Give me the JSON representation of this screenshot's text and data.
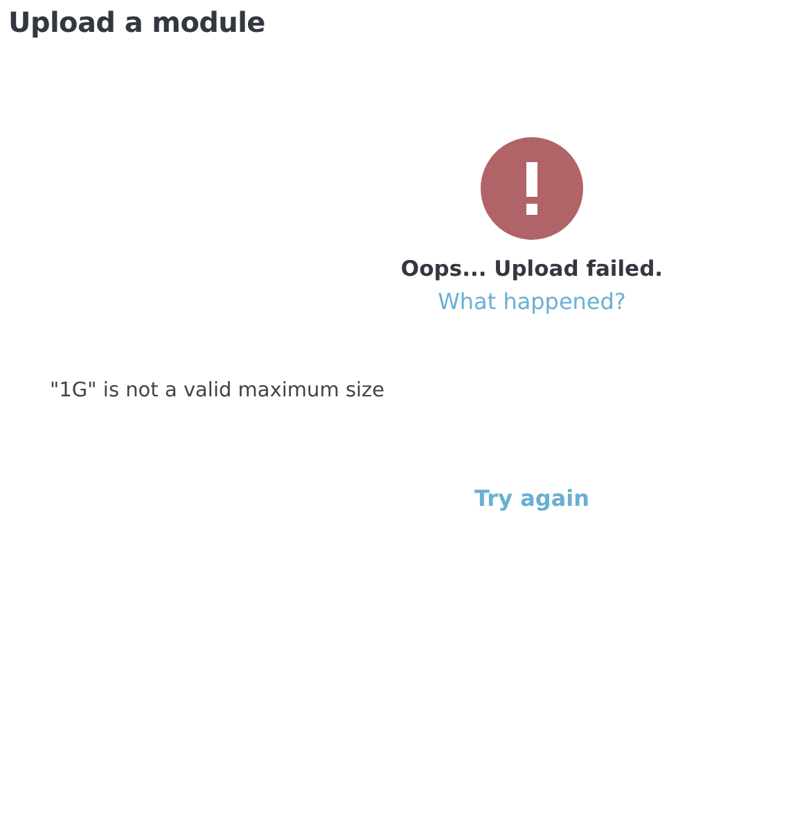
{
  "page": {
    "title": "Upload a module"
  },
  "result": {
    "failed": true,
    "heading": "Oops... Upload failed.",
    "link": "What happened?"
  },
  "message": "\"1G\" is not a valid maximum size",
  "action": "Try again"
}
